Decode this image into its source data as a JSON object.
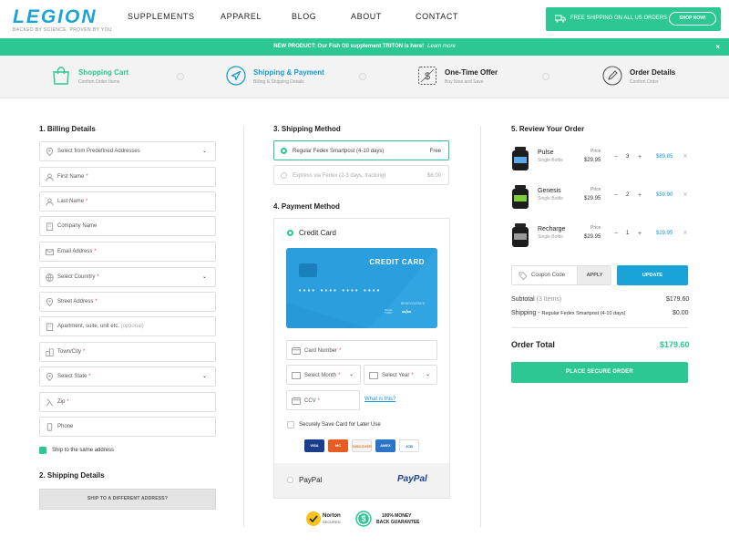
{
  "brand": {
    "logo": "LEGION",
    "tagline": "BACKED BY SCIENCE. PROVEN BY YOU"
  },
  "nav": [
    "SUPPLEMENTS",
    "APPAREL",
    "BLOG",
    "ABOUT",
    "CONTACT"
  ],
  "shipping_banner": {
    "text": "FREE SHIPPING ON ALL US ORDERS",
    "button": "SHOP NOW!"
  },
  "promo": {
    "text": "NEW PRODUCT: Our Fish Oil supplement TRITON is here!",
    "link": "Learn more",
    "close": "×"
  },
  "steps": [
    {
      "title": "Shopping Cart",
      "sub": "Confirm Order Items",
      "color": "#2cc793",
      "icon": "shopping-bag-icon"
    },
    {
      "title": "Shipping & Payment",
      "sub": "Billing & Shipping Details",
      "color": "#1a9ad6",
      "icon": "navigation-arrow-icon"
    },
    {
      "title": "One-Time Offer",
      "sub": "Buy Now and Save",
      "color": "#222222",
      "icon": "offer-dollar-icon"
    },
    {
      "title": "Order Details",
      "sub": "Confirm Order",
      "color": "#222222",
      "icon": "pen-icon"
    }
  ],
  "billing": {
    "heading": "1. Billing Details",
    "fields": [
      {
        "label": "Select from Predefined Addresses",
        "req": "",
        "opt": "",
        "icon": "pin-icon"
      },
      {
        "label": "First Name",
        "req": "*",
        "opt": "",
        "icon": "user-icon"
      },
      {
        "label": "Last Name",
        "req": "*",
        "opt": "",
        "icon": "user-icon"
      },
      {
        "label": "Company Name",
        "req": "",
        "opt": "",
        "icon": "building-icon"
      },
      {
        "label": "Email Address",
        "req": "*",
        "opt": "",
        "icon": "envelope-icon"
      },
      {
        "label": "Select Counrtry",
        "req": "*",
        "opt": "",
        "icon": "globe-icon"
      },
      {
        "label": "Street Address",
        "req": "*",
        "opt": "",
        "icon": "pin-icon"
      },
      {
        "label": "Apartment, suite, unit etc.",
        "req": "",
        "opt": "(optional)",
        "icon": "building-icon"
      },
      {
        "label": "Town/City",
        "req": "*",
        "opt": "",
        "icon": "city-icon"
      },
      {
        "label": "Select State",
        "req": "*",
        "opt": "",
        "icon": "pin-icon"
      },
      {
        "label": "Zip",
        "req": "*",
        "opt": "",
        "icon": "zip-icon"
      },
      {
        "label": "Phone",
        "req": "",
        "opt": "",
        "icon": "phone-icon"
      }
    ],
    "ship_same": "Ship to the same address"
  },
  "shipping_details": {
    "heading": "2. Shipping Details",
    "button": "SHIP TO A DIFFERENT ADDRESS?"
  },
  "shipping_method": {
    "heading": "3. Shipping Method",
    "options": [
      {
        "label": "Regular Fedex Smartpost (4-10 days)",
        "price": "Free"
      },
      {
        "label": "Express via Fedex (2-3 days, tracking)",
        "price": "$6.00"
      }
    ]
  },
  "payment": {
    "heading": "4. Payment Method",
    "credit_label": "Credit Card",
    "card": {
      "title": "CREDIT CARD",
      "number": "•••• •••• •••• ••••",
      "name_hint": "BENEVOLENCE",
      "valid_hint": "VALID THRU",
      "expiry": "••/••"
    },
    "card_number": "Card Number",
    "month": "Select Month",
    "year": "Select Year",
    "cvv": "CCV",
    "whats_this": "What is this?",
    "save": "Securely Save Card for Later Use",
    "cards": [
      "VISA",
      "MC",
      "DISCOVER",
      "AMEX",
      "JCB"
    ],
    "paypal_label": "PayPal",
    "paypal_logo": "PayPal",
    "star": "*"
  },
  "badges": {
    "norton": "Norton",
    "norton_sub": "SECURED",
    "money_line1": "100% MONEY",
    "money_line2": "BACK GUARANTEE"
  },
  "review": {
    "heading": "5. Review Your Order",
    "price_label": "Price",
    "minus": "−",
    "plus": "+",
    "remove": "×",
    "products": [
      {
        "name": "Pulse",
        "sub": "Single Bottle",
        "price": "$29.95",
        "qty": "3",
        "total": "$89.85"
      },
      {
        "name": "Genesis",
        "sub": "Single Bottle",
        "price": "$29.95",
        "qty": "2",
        "total": "$59.90"
      },
      {
        "name": "Recharge",
        "sub": "Single Bottle",
        "price": "$29.95",
        "qty": "1",
        "total": "$29.95"
      }
    ],
    "coupon_placeholder": "Coupon Code",
    "apply": "APPLY",
    "update": "UPDATE",
    "subtotal_label": "Subtotal",
    "subtotal_items": "(3 Items)",
    "subtotal": "$179.60",
    "shipping_label": "Shipping",
    "shipping_method": "Regular Fedex Smartpost (4-10 days)",
    "shipping_dash": "-",
    "shipping": "$0.00",
    "total_label": "Order Total",
    "total": "$179.60",
    "place_order": "PLACE SECURE ORDER"
  },
  "colors": {
    "green": "#2cc793",
    "blue": "#1a9ad6",
    "card": "#2b9fdd"
  }
}
